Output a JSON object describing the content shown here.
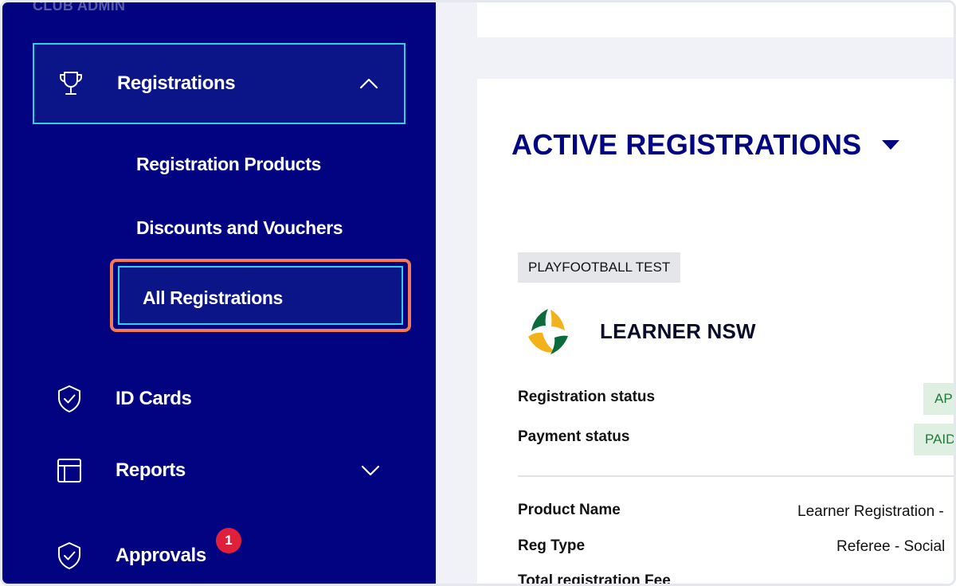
{
  "sidebar": {
    "section_label": "CLUB ADMIN",
    "registrations": {
      "label": "Registrations",
      "icon": "trophy-icon",
      "chevron": "chevron-up-icon"
    },
    "sub_items": [
      {
        "label": "Registration Products"
      },
      {
        "label": "Discounts and Vouchers"
      },
      {
        "label": "All Registrations"
      }
    ],
    "id_cards": {
      "label": "ID Cards",
      "icon": "shield-check-icon"
    },
    "reports": {
      "label": "Reports",
      "icon": "layout-icon",
      "chevron": "chevron-down-icon"
    },
    "approvals": {
      "label": "Approvals",
      "icon": "shield-check-icon",
      "badge": "1"
    },
    "colors": {
      "background": "#020381",
      "active_border": "#2fd0e0",
      "highlight": "#f47a55"
    }
  },
  "main": {
    "title": "ACTIVE REGISTRATIONS",
    "tag": "PLAYFOOTBALL TEST",
    "org_name": "LEARNER NSW",
    "rows": [
      {
        "label": "Registration status",
        "value": "APPROVED"
      },
      {
        "label": "Payment status",
        "value": "PAID"
      }
    ],
    "details": [
      {
        "label": "Product Name",
        "value": "Learner Registration -"
      },
      {
        "label": "Reg Type",
        "value": "Referee - Social"
      },
      {
        "label": "Total registration Fee",
        "value": ""
      }
    ],
    "colors": {
      "title": "#020381",
      "status_bg": "#dff0e2",
      "status_text": "#1f7a38"
    }
  }
}
